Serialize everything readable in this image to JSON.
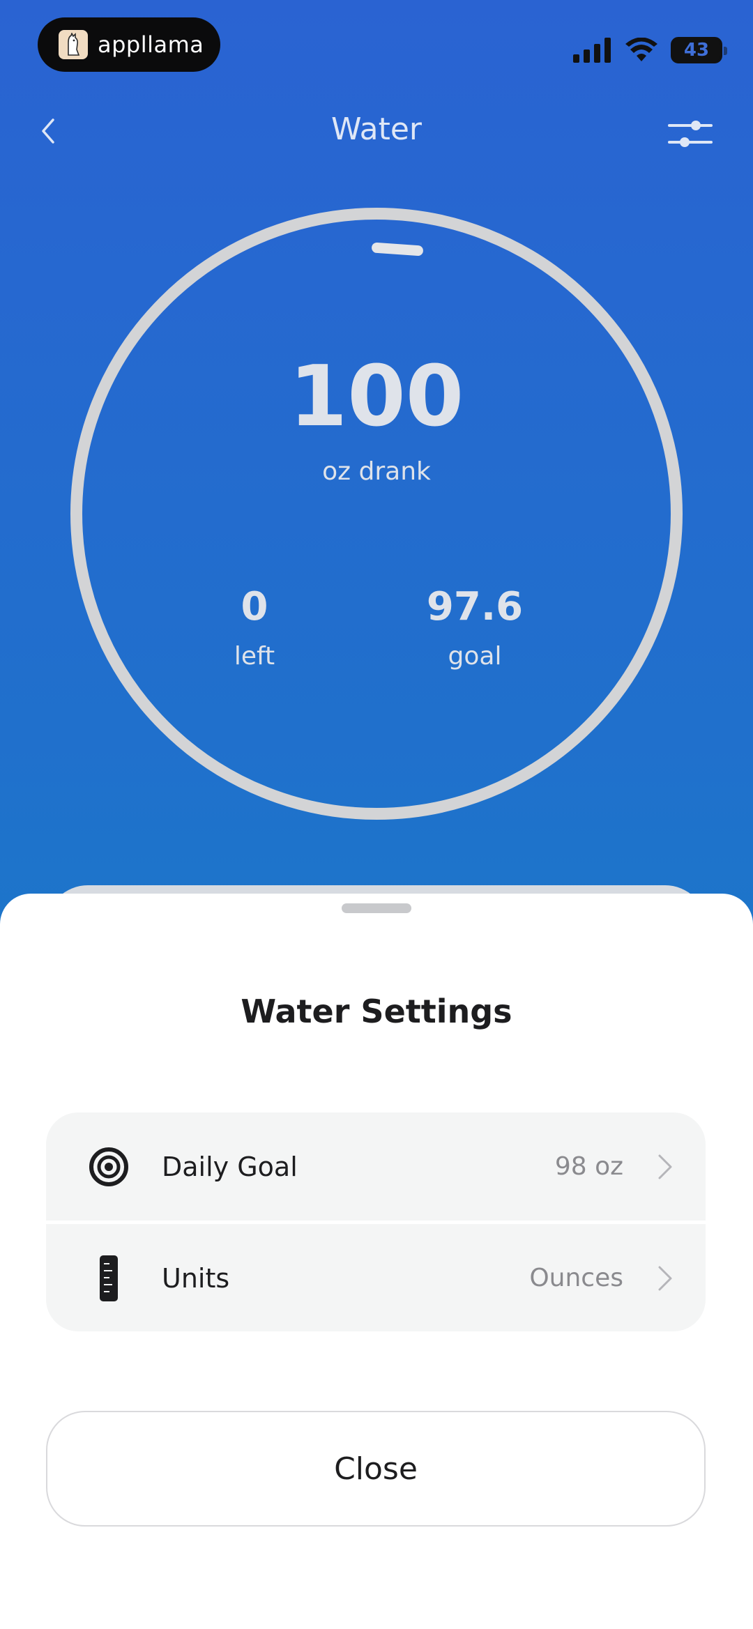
{
  "status_bar": {
    "brand": "appllama",
    "battery": "43"
  },
  "header": {
    "title": "Water"
  },
  "progress": {
    "drank_value": "100",
    "drank_label": "oz drank",
    "left_value": "0",
    "left_label": "left",
    "goal_value": "97.6",
    "goal_label": "goal"
  },
  "sheet": {
    "title": "Water Settings",
    "rows": [
      {
        "label": "Daily Goal",
        "value": "98 oz",
        "icon": "target-icon"
      },
      {
        "label": "Units",
        "value": "Ounces",
        "icon": "ruler-icon"
      }
    ],
    "close_label": "Close"
  },
  "colors": {
    "background_top": "#2a63d2",
    "background_bottom": "#1188c4",
    "ring": "#d3d4d6",
    "sheet": "#ffffff"
  }
}
